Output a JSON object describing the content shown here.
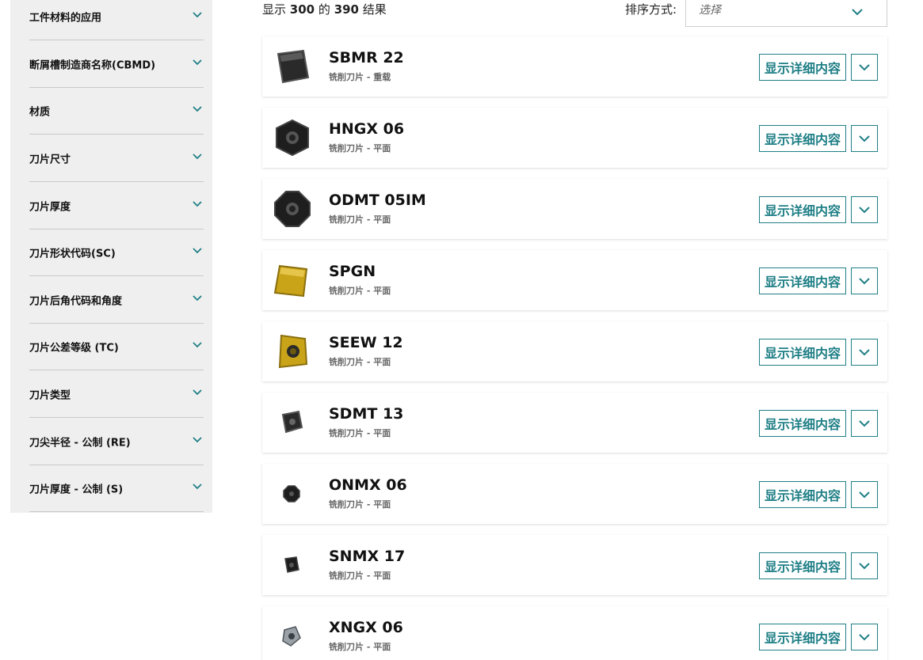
{
  "colors": {
    "accent": "#1f7f86",
    "sidebar_bg": "#efefef"
  },
  "filters": [
    {
      "label": "工件材料的应用"
    },
    {
      "label": "断屑槽制造商名称(CBMD)"
    },
    {
      "label": "材质"
    },
    {
      "label": "刀片尺寸"
    },
    {
      "label": "刀片厚度"
    },
    {
      "label": "刀片形状代码(SC)"
    },
    {
      "label": "刀片后角代码和角度"
    },
    {
      "label": "刀片公差等级 (TC)"
    },
    {
      "label": "刀片类型"
    },
    {
      "label": "刀尖半径 - 公制 (RE)"
    },
    {
      "label": "刀片厚度 - 公制 (S)"
    }
  ],
  "results": {
    "prefix": "显示",
    "shown": "300",
    "mid": "的",
    "total": "390",
    "suffix": "结果"
  },
  "sort": {
    "label": "排序方式:",
    "placeholder": "选择"
  },
  "products": [
    {
      "name": "SBMR 22",
      "category": "铣削刀片 - 重载",
      "icon": "square-dark-insert",
      "detail_label": "显示详细内容"
    },
    {
      "name": "HNGX 06",
      "category": "铣削刀片 - 平面",
      "icon": "hexagon-insert",
      "detail_label": "显示详细内容"
    },
    {
      "name": "ODMT 05IM",
      "category": "铣削刀片 - 平面",
      "icon": "octagon-insert",
      "detail_label": "显示详细内容"
    },
    {
      "name": "SPGN",
      "category": "铣削刀片 - 平面",
      "icon": "gold-square-insert",
      "detail_label": "显示详细内容"
    },
    {
      "name": "SEEW 12",
      "category": "铣削刀片 - 平面",
      "icon": "gold-square-hole-insert",
      "detail_label": "显示详细内容"
    },
    {
      "name": "SDMT 13",
      "category": "铣削刀片 - 平面",
      "icon": "small-square-insert",
      "detail_label": "显示详细内容"
    },
    {
      "name": "ONMX 06",
      "category": "铣削刀片 - 平面",
      "icon": "small-octagon-insert",
      "detail_label": "显示详细内容"
    },
    {
      "name": "SNMX 17",
      "category": "铣削刀片 - 平面",
      "icon": "small-square-insert",
      "detail_label": "显示详细内容"
    },
    {
      "name": "XNGX 06",
      "category": "铣削刀片 - 平面",
      "icon": "grey-insert",
      "detail_label": "显示详细内容"
    }
  ]
}
